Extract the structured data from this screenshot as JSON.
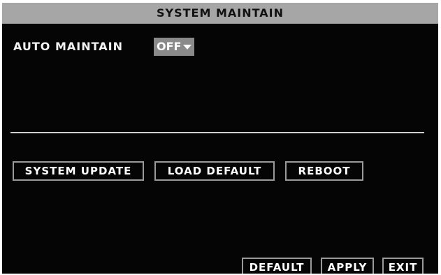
{
  "dialog": {
    "title": "SYSTEM MAINTAIN"
  },
  "settings": {
    "auto_maintain_label": "AUTO MAINTAIN",
    "auto_maintain_value": "OFF"
  },
  "actions": {
    "system_update": "SYSTEM UPDATE",
    "load_default": "LOAD DEFAULT",
    "reboot": "REBOOT"
  },
  "footer": {
    "default": "DEFAULT",
    "apply": "APPLY",
    "exit": "EXIT"
  },
  "colors": {
    "background": "#050505",
    "title_bar": "#a6a6a6",
    "text": "#f2f2f2",
    "dropdown_bg": "#8a8a8a",
    "button_border": "#9a9a9a"
  },
  "icons": {
    "dropdown": "chevron-down-icon"
  }
}
